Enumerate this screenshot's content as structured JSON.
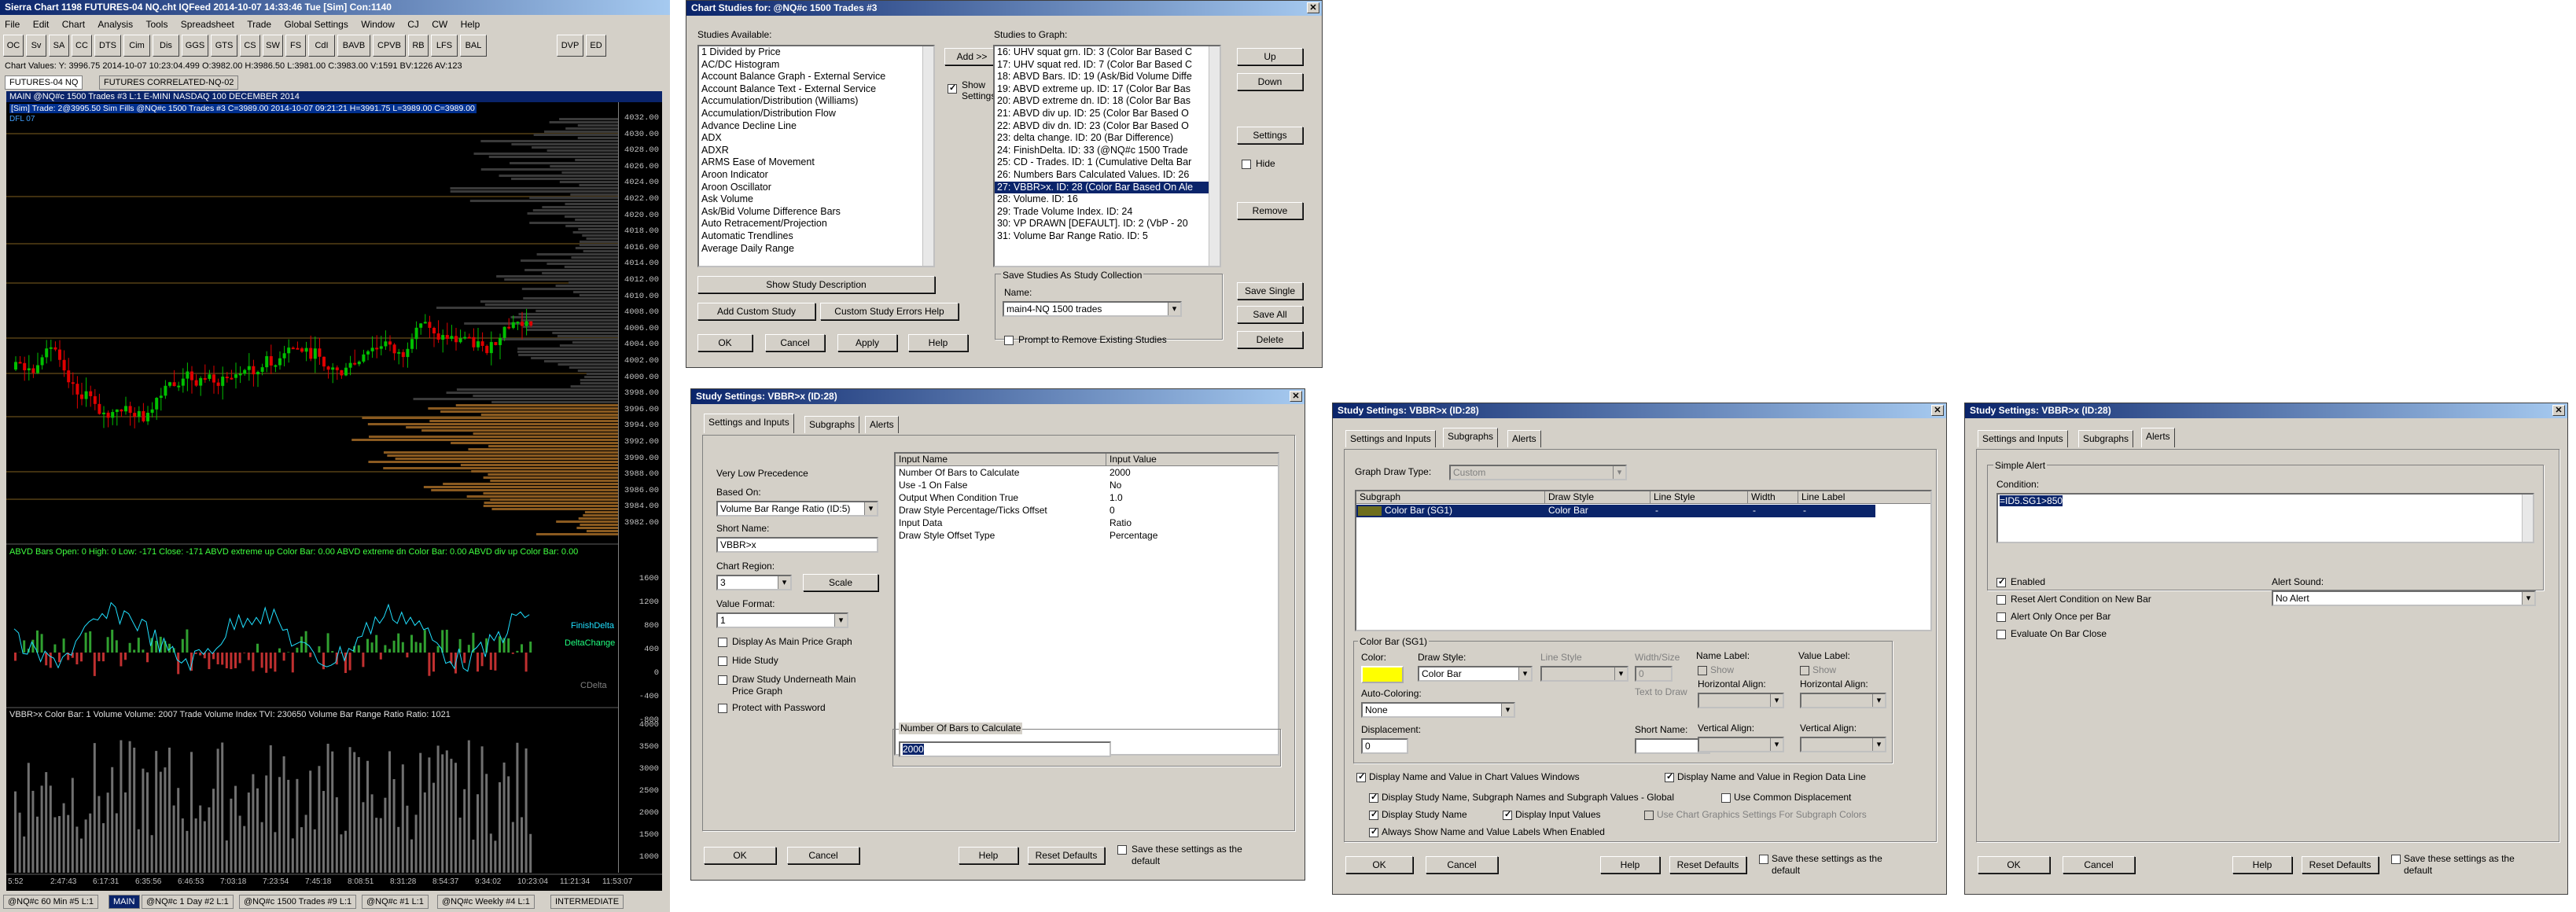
{
  "chart_window": {
    "title": "Sierra Chart 1198 FUTURES-04 NQ.cht  IQFeed 2014-10-07  14:33:46 Tue [Sim]  Con:1140",
    "menu": [
      "File",
      "Edit",
      "Chart",
      "Analysis",
      "Tools",
      "Spreadsheet",
      "Trade",
      "Global Settings",
      "Window",
      "CJ",
      "CW",
      "Help"
    ],
    "toolbar": [
      "OC",
      "Sv",
      "SA",
      "CC",
      "DTS",
      "Cim",
      "Dis",
      "GGS",
      "GTS",
      "CS",
      "SW",
      "FS",
      "CdI",
      "BAVB",
      "CPVB",
      "RB",
      "LFS",
      "BAL",
      "DVP",
      "ED"
    ],
    "values_line": "Chart Values: Y: 3996.75  2014-10-07  10:23:04.499  O:3982.00  H:3986.50  L:3981.00  C:3983.00  V:1591  BV:1226  AV:123",
    "page_tabs": [
      "FUTURES-04 NQ",
      "FUTURES CORRELATED-NQ-02"
    ],
    "inner_title": "MAIN  @NQ#c  1500 Trades  #3  L:1  E-MINI NASDAQ 100 DECEMBER 2014",
    "info_line": "[Sim]  Trade: 2@3995.50  Sim Fills  @NQ#c  1500 Trades  #3  C=3989.00  2014-10-07 09:21:21  H=3991.75  L=3989.00  C=3989.00",
    "sub_label": "DFL 07",
    "price_ticks": [
      "4032.00",
      "4030.00",
      "4028.00",
      "4026.00",
      "4024.00",
      "4022.00",
      "4020.00",
      "4018.00",
      "4016.00",
      "4014.00",
      "4012.00",
      "4010.00",
      "4008.00",
      "4006.00",
      "4004.00",
      "4002.00",
      "4000.00",
      "3998.00",
      "3996.00",
      "3994.00",
      "3992.00",
      "3990.00",
      "3988.00",
      "3986.00",
      "3984.00",
      "3982.00"
    ],
    "abvd_line": "ABVD Bars  Open: 0  High: 0  Low: -171  Close: -171  ABVD extreme up  Color Bar: 0.00  ABVD extreme dn  Color Bar: 0.00  ABVD div up  Color Bar: 0.00",
    "mid_ticks": [
      "1600",
      "1200",
      "800",
      "400",
      "0",
      "-400",
      "-800"
    ],
    "mid_labels": [
      "FinishDelta",
      "DeltaChange",
      "CDelta"
    ],
    "vol_line": "VBBR>x  Color Bar: 1  Volume  Volume: 2007  Trade Volume Index  TVI: 230650  Volume Bar Range Ratio  Ratio: 1021",
    "vol_ticks": [
      "4000",
      "3500",
      "3000",
      "2500",
      "2000",
      "1500",
      "1000"
    ],
    "time_ticks": [
      "5:52",
      "2:47:43",
      "6:17:31",
      "6:35:56",
      "6:46:53",
      "7:03:18",
      "7:23:54",
      "7:45:18",
      "8:08:51",
      "8:31:28",
      "8:54:37",
      "9:34:02",
      "10:23:04",
      "11:21:34",
      "11:53:07"
    ],
    "bottom_tabs": [
      "@NQ#c  60 Min  #5  L:1",
      "MAIN",
      "@NQ#c  1 Day  #2  L:1",
      "@NQ#c  1500 Trades  #9  L:1",
      "@NQ#c  #1  L:1",
      "@NQ#c  Weekly  #4  L:1",
      "INTERMEDIATE"
    ]
  },
  "studies_dialog": {
    "title": "Chart Studies for: @NQ#c  1500 Trades  #3",
    "available_label": "Studies Available:",
    "to_graph_label": "Studies to Graph:",
    "available": [
      "1 Divided by Price",
      "AC/DC Histogram",
      "Account Balance Graph - External Service",
      "Account Balance Text - External Service",
      "Accumulation/Distribution (Williams)",
      "Accumulation/Distribution Flow",
      "Advance Decline Line",
      "ADX",
      "ADXR",
      "ARMS Ease of Movement",
      "Aroon Indicator",
      "Aroon Oscillator",
      "Ask Volume",
      "Ask/Bid Volume Difference Bars",
      "Auto Retracement/Projection",
      "Automatic Trendlines",
      "Average Daily Range"
    ],
    "to_graph": [
      "16: UHV squat grn. ID: 3 (Color Bar Based C",
      "17: UHV squat red. ID: 7 (Color Bar Based C",
      "18: ABVD Bars. ID: 19 (Ask/Bid Volume Diffe",
      "19: ABVD extreme up. ID: 17 (Color Bar Bas",
      "20: ABVD extreme dn. ID: 18 (Color Bar Bas",
      "21: ABVD div up. ID: 25 (Color Bar Based O",
      "22: ABVD div dn. ID: 23 (Color Bar Based O",
      "23: delta change. ID: 20 (Bar Difference)",
      "24: FinishDelta. ID: 33 (@NQ#c  1500 Trade",
      "25: CD - Trades. ID: 1 (Cumulative Delta Bar",
      "26: Numbers Bars Calculated Values. ID: 26",
      "27: VBBR>x. ID: 28 (Color Bar Based On Ale",
      "28: Volume. ID: 16",
      "29: Trade Volume Index. ID: 24",
      "30: VP DRAWN [DEFAULT]. ID: 2 (VbP - 20",
      "31: Volume Bar Range Ratio. ID: 5"
    ],
    "selected_index": 11,
    "add_btn": "Add >>",
    "show_settings": "Show Settings",
    "up": "Up",
    "down": "Down",
    "settings": "Settings",
    "hide": "Hide",
    "remove": "Remove",
    "show_desc": "Show Study Description",
    "add_custom": "Add Custom Study",
    "custom_errors": "Custom Study Errors Help",
    "save_collection_label": "Save Studies As Study Collection",
    "name_label": "Name:",
    "collection_name": "main4-NQ 1500 trades",
    "save_single": "Save Single",
    "save_all": "Save All",
    "delete": "Delete",
    "prompt_remove": "Prompt to Remove Existing Studies",
    "ok": "OK",
    "cancel": "Cancel",
    "apply": "Apply",
    "help": "Help"
  },
  "settings_dialog": {
    "title": "Study Settings: VBBR>x  (ID:28)",
    "tabs": [
      "Settings and Inputs",
      "Subgraphs",
      "Alerts"
    ],
    "precedence": "Very Low Precedence",
    "based_on_label": "Based On:",
    "based_on": "Volume Bar Range Ratio (ID:5)",
    "short_name_label": "Short Name:",
    "short_name": "VBBR>x",
    "chart_region_label": "Chart Region:",
    "chart_region": "3",
    "scale": "Scale",
    "value_format_label": "Value Format:",
    "value_format": "1",
    "display_main": "Display As Main Price Graph",
    "hide_study": "Hide Study",
    "draw_under": "Draw Study Underneath Main Price Graph",
    "protect": "Protect with Password",
    "col_input": "Input Name",
    "col_value": "Input Value",
    "inputs": [
      [
        "Number Of Bars to Calculate",
        "2000"
      ],
      [
        "Use -1 On False",
        "No"
      ],
      [
        "Output When Condition True",
        "1.0"
      ],
      [
        "Draw Style Percentage/Ticks Offset",
        "0"
      ],
      [
        "Input Data",
        "Ratio"
      ],
      [
        "Draw Style Offset Type",
        "Percentage"
      ]
    ],
    "edit_label": "Number Of Bars to Calculate",
    "edit_value": "2000",
    "ok": "OK",
    "cancel": "Cancel",
    "help": "Help",
    "reset": "Reset Defaults",
    "save_default": "Save these settings as the default"
  },
  "subgraphs_dialog": {
    "title": "Study Settings: VBBR>x  (ID:28)",
    "tabs": [
      "Settings and Inputs",
      "Subgraphs",
      "Alerts"
    ],
    "graph_draw_type_label": "Graph Draw Type:",
    "graph_draw_type": "Custom",
    "cols": [
      "Subgraph",
      "Draw Style",
      "Line Style",
      "Width",
      "Line Label"
    ],
    "row": [
      "Color Bar (SG1)",
      "Color Bar",
      "-",
      "-",
      "-"
    ],
    "group_title": "Color Bar (SG1)",
    "color_label": "Color:",
    "draw_style_label": "Draw Style:",
    "draw_style": "Color Bar",
    "line_style_label": "Line Style",
    "width_size_label": "Width/Size",
    "width_value": "0",
    "auto_coloring_label": "Auto-Coloring:",
    "auto_coloring": "None",
    "displacement_label": "Displacement:",
    "displacement": "0",
    "text_to_draw_label": "Text to Draw",
    "short_name_label": "Short Name:",
    "name_label_group": "Name Label:",
    "value_label_group": "Value Label:",
    "show": "Show",
    "horiz_align": "Horizontal Align:",
    "vert_align": "Vertical Align:",
    "disp_chart_values": "Display Name and Value in Chart Values Windows",
    "disp_region": "Display Name and Value in Region Data Line",
    "disp_global": "Display Study Name, Subgraph Names and Subgraph Values - Global",
    "common_disp": "Use Common Displacement",
    "disp_study_name": "Display Study Name",
    "disp_inputs": "Display Input Values",
    "use_chart_graphics": "Use Chart Graphics Settings For Subgraph Colors",
    "always_show": "Always Show Name and Value Labels When Enabled",
    "bar_color": "#ffff00",
    "ok": "OK",
    "cancel": "Cancel",
    "help": "Help",
    "reset": "Reset Defaults",
    "save_default": "Save these settings as the default"
  },
  "alerts_dialog": {
    "title": "Study Settings: VBBR>x  (ID:28)",
    "tabs": [
      "Settings and Inputs",
      "Subgraphs",
      "Alerts"
    ],
    "simple_alert": "Simple Alert",
    "condition_label": "Condition:",
    "condition": "=ID5.SG1>850",
    "alert_sound_label": "Alert Sound:",
    "alert_sound": "No Alert",
    "enabled": "Enabled",
    "reset_new_bar": "Reset Alert Condition on New Bar",
    "once_per_bar": "Alert Only Once per Bar",
    "on_bar_close": "Evaluate On Bar Close",
    "ok": "OK",
    "cancel": "Cancel",
    "help": "Help",
    "reset": "Reset Defaults",
    "save_default": "Save these settings as the default"
  },
  "colors": {
    "title_bar": "#0a246a",
    "dialog_bg": "#d4d0c8",
    "chart_bg": "#000000",
    "selection": "#0a246a",
    "up_bar": "#00c000",
    "down_bar": "#e00000"
  }
}
